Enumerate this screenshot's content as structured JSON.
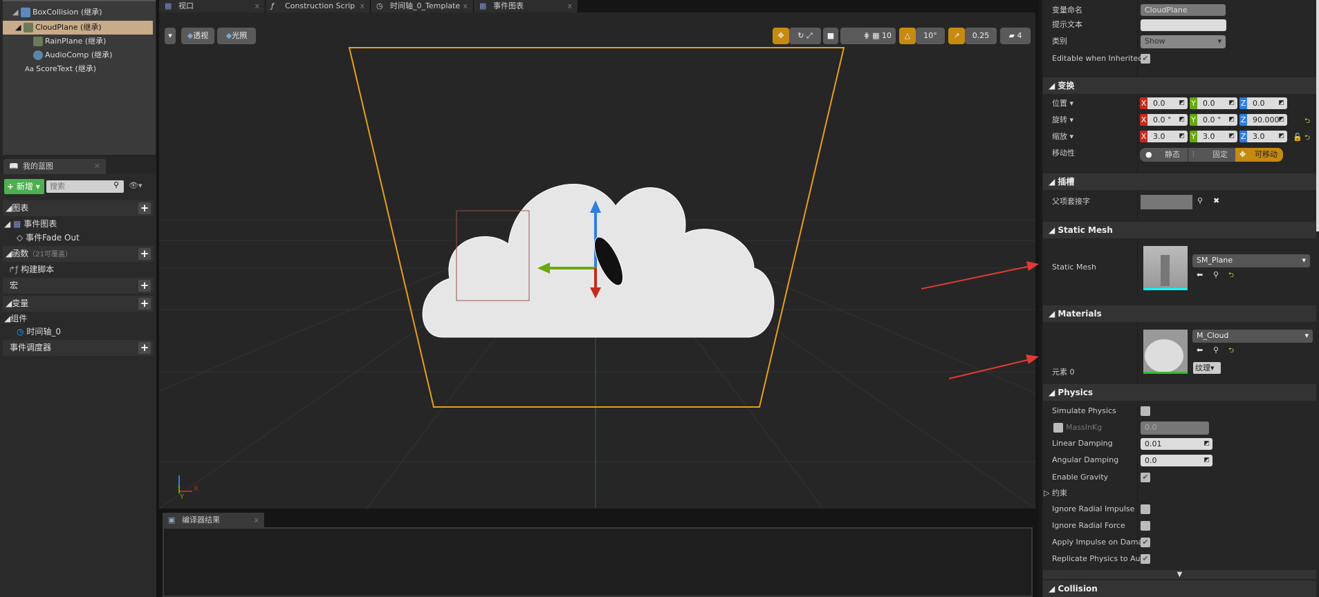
{
  "components": {
    "items": [
      {
        "label": "BoxCollision (继承)"
      },
      {
        "label": "CloudPlane (继承)",
        "selected": true
      },
      {
        "label": "RainPlane (继承)"
      },
      {
        "label": "AudioComp (继承)"
      },
      {
        "label": "ScoreText (继承)"
      }
    ]
  },
  "my_blueprint": {
    "tab": "我的蓝图",
    "add_label": "新增",
    "search_placeholder": "搜索",
    "graphs_header": "图表",
    "event_graph": "事件图表",
    "event_fade_out": "事件Fade Out",
    "functions_header": "函数",
    "functions_note": "（21可覆盖）",
    "construction_script": "构建脚本",
    "macros_header": "宏",
    "variables_header": "变量",
    "components_header": "组件",
    "timeline": "时间轴_0",
    "dispatchers_header": "事件调度器"
  },
  "tabs": [
    {
      "label": "视口"
    },
    {
      "label": "Construction Scrip"
    },
    {
      "label": "时间轴_0_Template"
    },
    {
      "label": "事件图表"
    }
  ],
  "viewport": {
    "perspective": "透视",
    "lit": "光照",
    "grid_snap": "10",
    "rot_snap": "10°",
    "scale_snap": "0.25",
    "cam_speed": "4",
    "axis_x": "X",
    "axis_y": "Y"
  },
  "compiler": {
    "tab": "编译器结果"
  },
  "details": {
    "var_name_label": "变量命名",
    "var_name": "CloudPlane",
    "tooltip_label": "提示文本",
    "tooltip": "",
    "category_label": "类别",
    "category": "Show",
    "editable_label": "Editable when Inherited",
    "editable": true,
    "transform_header": "变换",
    "location_label": "位置",
    "rotation_label": "旋转",
    "scale_label": "缩放",
    "location": [
      "0.0",
      "0.0",
      "0.0"
    ],
    "rotation": [
      "0.0 °",
      "0.0 °",
      "90.000°"
    ],
    "scale": [
      "3.0",
      "3.0",
      "3.0"
    ],
    "axes": [
      "X",
      "Y",
      "Z"
    ],
    "mobility_label": "移动性",
    "mobility": [
      "静态",
      "固定",
      "可移动"
    ],
    "mobility_selected": "可移动",
    "sockets_header": "插槽",
    "parent_socket_label": "父项套接字",
    "static_mesh_header": "Static Mesh",
    "static_mesh_label": "Static Mesh",
    "static_mesh": "SM_Plane",
    "materials_header": "Materials",
    "element0_label": "元素 0",
    "material": "M_Cloud",
    "texture_btn": "纹理",
    "physics_header": "Physics",
    "physics": [
      {
        "label": "Simulate Physics",
        "checked": false
      },
      {
        "label": "MassInKg",
        "value": "0.0"
      },
      {
        "label": "Linear Damping",
        "value": "0.01"
      },
      {
        "label": "Angular Damping",
        "value": "0.0"
      },
      {
        "label": "Enable Gravity",
        "checked": true
      },
      {
        "label": "约束"
      },
      {
        "label": "Ignore Radial Impulse",
        "checked": false
      },
      {
        "label": "Ignore Radial Force",
        "checked": false
      },
      {
        "label": "Apply Impulse on Damag",
        "checked": true
      },
      {
        "label": "Replicate Physics to Aut",
        "checked": true
      }
    ],
    "collision_header": "Collision"
  },
  "colors": {
    "accent": "#c78a10",
    "selected": "#c8ab88",
    "x": "#c42b1c",
    "y": "#6aa80f",
    "z": "#2f7de1",
    "annotation": "#e53935"
  }
}
